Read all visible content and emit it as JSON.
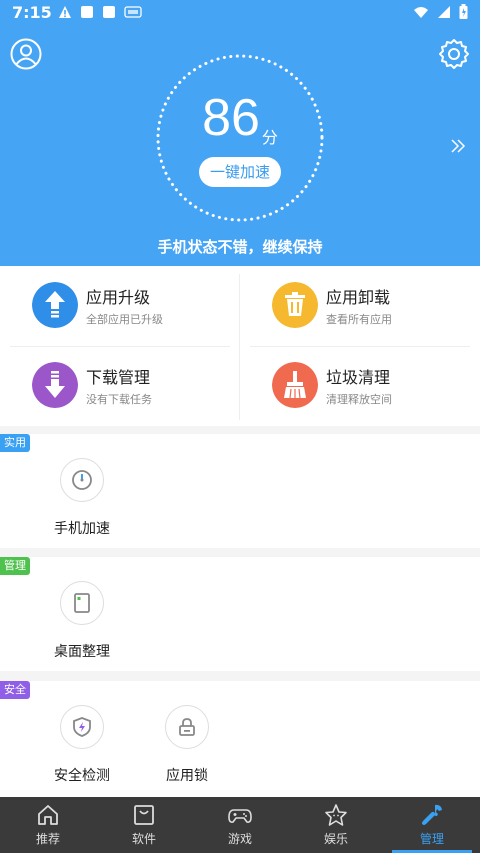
{
  "status_bar": {
    "time": "7:15"
  },
  "hero": {
    "score": "86",
    "score_unit": "分",
    "boost_label": "一键加速",
    "status_message": "手机状态不错，继续保持"
  },
  "tools": [
    {
      "title": "应用升级",
      "subtitle": "全部应用已升级",
      "color": "#2f8fe8",
      "icon": "upgrade-arrow-icon"
    },
    {
      "title": "应用卸载",
      "subtitle": "查看所有应用",
      "color": "#f5b82e",
      "icon": "trash-icon"
    },
    {
      "title": "下载管理",
      "subtitle": "没有下载任务",
      "color": "#9b57c9",
      "icon": "download-icon"
    },
    {
      "title": "垃圾清理",
      "subtitle": "清理释放空间",
      "color": "#f06a4f",
      "icon": "broom-icon"
    }
  ],
  "sections": [
    {
      "tag": "实用",
      "tag_color": "#3aa0f2",
      "items": [
        {
          "label": "手机加速",
          "icon": "speedometer-icon"
        }
      ]
    },
    {
      "tag": "管理",
      "tag_color": "#4fc14f",
      "items": [
        {
          "label": "桌面整理",
          "icon": "desktop-organize-icon"
        }
      ]
    },
    {
      "tag": "安全",
      "tag_color": "#8f5fe8",
      "items": [
        {
          "label": "安全检测",
          "icon": "shield-icon"
        },
        {
          "label": "应用锁",
          "icon": "lock-icon"
        }
      ]
    }
  ],
  "bottom_nav": [
    {
      "label": "推荐",
      "icon": "home-icon",
      "active": false
    },
    {
      "label": "软件",
      "icon": "bag-icon",
      "active": false
    },
    {
      "label": "游戏",
      "icon": "gamepad-icon",
      "active": false
    },
    {
      "label": "娱乐",
      "icon": "star-icon",
      "active": false
    },
    {
      "label": "管理",
      "icon": "wrench-icon",
      "active": true
    }
  ],
  "colors": {
    "primary": "#46a4f5",
    "nav_bg": "#3a3a3a",
    "nav_active": "#3aa0f2"
  }
}
